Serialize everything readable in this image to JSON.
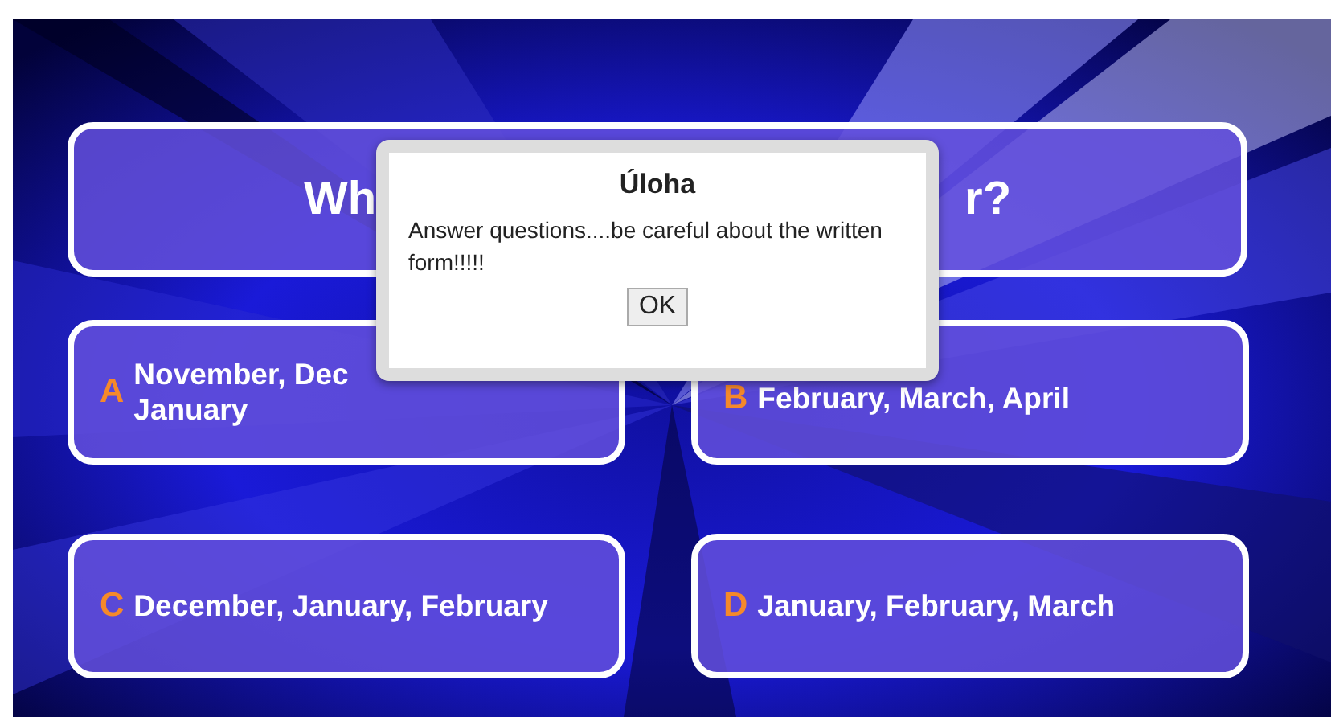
{
  "question": {
    "visible_parts": [
      "Wh",
      "r?"
    ]
  },
  "answers": [
    {
      "letter": "A",
      "lines": [
        "November, Dec",
        "January"
      ]
    },
    {
      "letter": "B",
      "lines": [
        "February, March, April"
      ]
    },
    {
      "letter": "C",
      "lines": [
        "December, January, February"
      ]
    },
    {
      "letter": "D",
      "lines": [
        "January, February, March"
      ]
    }
  ],
  "dialog": {
    "title": "Úloha",
    "message": "Answer questions....be careful about the written form!!!!!",
    "button": "OK"
  }
}
